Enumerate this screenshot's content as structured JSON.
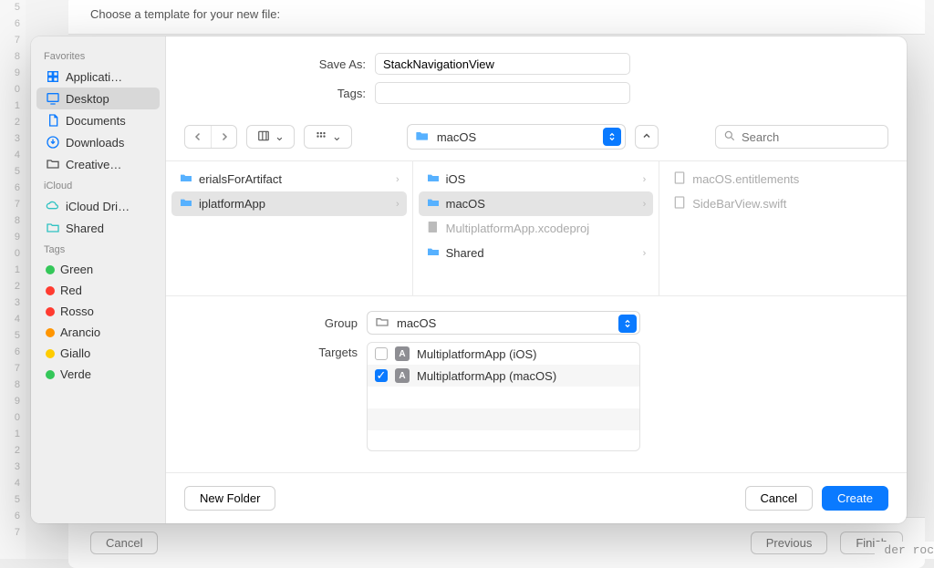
{
  "backdrop": {
    "template_hint": "Choose a template for your new file:",
    "btn_cancel": "Cancel",
    "btn_previous": "Previous",
    "btn_finish": "Finish",
    "code_snippet": "der roc"
  },
  "sidebar": {
    "sections": {
      "favorites": "Favorites",
      "icloud": "iCloud",
      "tags": "Tags"
    },
    "favorites": [
      {
        "label": "Applicati…"
      },
      {
        "label": "Desktop",
        "selected": true
      },
      {
        "label": "Documents"
      },
      {
        "label": "Downloads"
      },
      {
        "label": "Creative…"
      }
    ],
    "icloud": [
      {
        "label": "iCloud Dri…"
      },
      {
        "label": "Shared"
      }
    ],
    "tags": [
      {
        "label": "Green",
        "color": "#34c759"
      },
      {
        "label": "Red",
        "color": "#ff3b30"
      },
      {
        "label": "Rosso",
        "color": "#ff3b30"
      },
      {
        "label": "Arancio",
        "color": "#ff9500"
      },
      {
        "label": "Giallo",
        "color": "#ffcc00"
      },
      {
        "label": "Verde",
        "color": "#34c759"
      }
    ]
  },
  "form": {
    "save_as_label": "Save As:",
    "save_as_value": "StackNavigationView",
    "tags_label": "Tags:",
    "tags_value": ""
  },
  "toolbar": {
    "location": "macOS",
    "search_placeholder": "Search"
  },
  "columns": {
    "col1": [
      {
        "label": "erialsForArtifact",
        "folder": true,
        "chevron": true
      },
      {
        "label": "iplatformApp",
        "folder": true,
        "chevron": true,
        "selected": true
      }
    ],
    "col2": [
      {
        "label": "iOS",
        "folder": true,
        "chevron": true
      },
      {
        "label": "macOS",
        "folder": true,
        "chevron": true,
        "selected": true
      },
      {
        "label": "MultiplatformApp.xcodeproj",
        "folder": false,
        "dim": true
      },
      {
        "label": "Shared",
        "folder": true,
        "chevron": true
      }
    ],
    "col3": [
      {
        "label": "macOS.entitlements",
        "dim": true
      },
      {
        "label": "SideBarView.swift",
        "dim": true
      }
    ]
  },
  "lower": {
    "group_label": "Group",
    "group_value": "macOS",
    "targets_label": "Targets",
    "targets": [
      {
        "label": "MultiplatformApp (iOS)",
        "checked": false
      },
      {
        "label": "MultiplatformApp (macOS)",
        "checked": true
      }
    ]
  },
  "footer": {
    "new_folder": "New Folder",
    "cancel": "Cancel",
    "create": "Create"
  }
}
